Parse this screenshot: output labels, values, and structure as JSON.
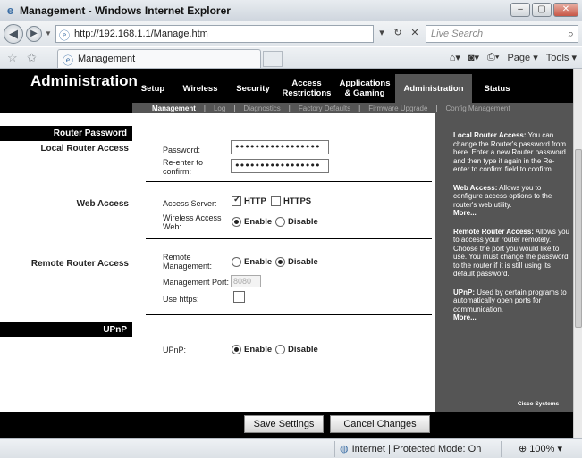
{
  "window": {
    "title": "Management - Windows Internet Explorer",
    "minimize": "–",
    "maximize": "▢",
    "close": "✕"
  },
  "address_bar": {
    "url": "http://192.168.1.1/Manage.htm",
    "search_placeholder": "Live Search"
  },
  "tabs": [
    {
      "label": "Management"
    }
  ],
  "toolbar": {
    "page_label": "Page",
    "tools_label": "Tools"
  },
  "router": {
    "heading": "Administration",
    "main_nav": [
      {
        "label": "Setup"
      },
      {
        "label": "Wireless"
      },
      {
        "label": "Security"
      },
      {
        "label": "Access\nRestrictions"
      },
      {
        "label": "Applications\n& Gaming"
      },
      {
        "label": "Administration"
      },
      {
        "label": "Status"
      }
    ],
    "active_main_nav": "Administration",
    "sub_nav": [
      {
        "label": "Management"
      },
      {
        "label": "Log"
      },
      {
        "label": "Diagnostics"
      },
      {
        "label": "Factory Defaults"
      },
      {
        "label": "Firmware Upgrade"
      },
      {
        "label": "Config Management"
      }
    ],
    "active_sub_nav": "Management",
    "sections": {
      "router_password_heading": "Router Password",
      "local_router_access": "Local Router Access",
      "web_access": "Web Access",
      "remote_router_access": "Remote Router Access",
      "upnp_heading": "UPnP"
    },
    "fields": {
      "password_label": "Password:",
      "password_value": "•••••••••••••••••",
      "reenter_label_1": "Re-enter to",
      "reenter_label_2": "confirm:",
      "reenter_value": "•••••••••••••••••",
      "access_server_label": "Access Server:",
      "http_label": "HTTP",
      "http_checked": true,
      "https_label": "HTTPS",
      "https_checked": false,
      "wireless_web_label_1": "Wireless Access",
      "wireless_web_label_2": "Web:",
      "enable_label": "Enable",
      "disable_label": "Disable",
      "wireless_web_value": "Enable",
      "remote_mgmt_label_1": "Remote",
      "remote_mgmt_label_2": "Management:",
      "remote_mgmt_value": "Disable",
      "mgmt_port_label": "Management Port:",
      "mgmt_port_value": "8080",
      "use_https_label": "Use https:",
      "use_https_checked": false,
      "upnp_label": "UPnP:",
      "upnp_value": "Enable"
    },
    "help": {
      "local_title": "Local Router Access:",
      "local_text": "You can change the Router's password from here. Enter a new Router password and then type it again in the Re-enter to confirm field to confirm.",
      "web_title": "Web Access:",
      "web_text": "Allows you to configure access options to the router's web utility.",
      "more_1": "More...",
      "remote_title": "Remote Router Access:",
      "remote_text": "Allows you to access your router remotely. Choose the port you would like to use. You must change the password to the router if it is still using its default password.",
      "upnp_title": "UPnP:",
      "upnp_text": "Used by certain programs to automatically open ports for communication.",
      "more_2": "More..."
    },
    "brand": "Cisco Systems",
    "buttons": {
      "save": "Save Settings",
      "cancel": "Cancel Changes"
    }
  },
  "status_bar": {
    "zone": "Internet | Protected Mode: On",
    "zoom": "100%"
  }
}
